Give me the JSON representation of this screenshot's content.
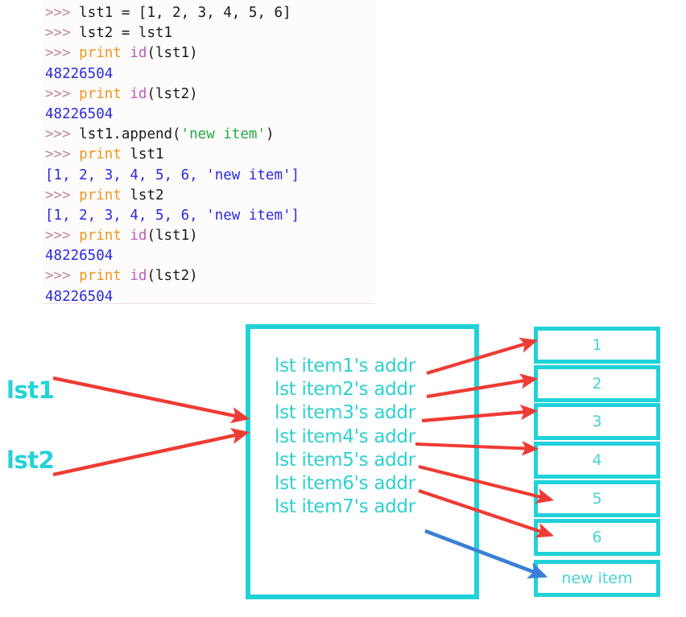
{
  "console": {
    "lines": [
      [
        {
          "t": ">>> ",
          "c": "prompt"
        },
        {
          "t": "lst1 = [1, 2, 3, 4, 5, 6]",
          "c": "plain"
        }
      ],
      [
        {
          "t": ">>> ",
          "c": "prompt"
        },
        {
          "t": "lst2 = lst1",
          "c": "plain"
        }
      ],
      [
        {
          "t": ">>> ",
          "c": "prompt"
        },
        {
          "t": "print ",
          "c": "keyword"
        },
        {
          "t": "id",
          "c": "builtin"
        },
        {
          "t": "(lst1)",
          "c": "plain"
        }
      ],
      [
        {
          "t": "48226504",
          "c": "output"
        }
      ],
      [
        {
          "t": ">>> ",
          "c": "prompt"
        },
        {
          "t": "print ",
          "c": "keyword"
        },
        {
          "t": "id",
          "c": "builtin"
        },
        {
          "t": "(lst2)",
          "c": "plain"
        }
      ],
      [
        {
          "t": "48226504",
          "c": "output"
        }
      ],
      [
        {
          "t": ">>> ",
          "c": "prompt"
        },
        {
          "t": "lst1.append(",
          "c": "plain"
        },
        {
          "t": "'new item'",
          "c": "string"
        },
        {
          "t": ")",
          "c": "plain"
        }
      ],
      [
        {
          "t": ">>> ",
          "c": "prompt"
        },
        {
          "t": "print ",
          "c": "keyword"
        },
        {
          "t": "lst1",
          "c": "plain"
        }
      ],
      [
        {
          "t": "[1, 2, 3, 4, 5, 6, 'new item']",
          "c": "output"
        }
      ],
      [
        {
          "t": ">>> ",
          "c": "prompt"
        },
        {
          "t": "print ",
          "c": "keyword"
        },
        {
          "t": "lst2",
          "c": "plain"
        }
      ],
      [
        {
          "t": "[1, 2, 3, 4, 5, 6, 'new item']",
          "c": "output"
        }
      ],
      [
        {
          "t": ">>> ",
          "c": "prompt"
        },
        {
          "t": "print ",
          "c": "keyword"
        },
        {
          "t": "id",
          "c": "builtin"
        },
        {
          "t": "(lst1)",
          "c": "plain"
        }
      ],
      [
        {
          "t": "48226504",
          "c": "output"
        }
      ],
      [
        {
          "t": ">>> ",
          "c": "prompt"
        },
        {
          "t": "print ",
          "c": "keyword"
        },
        {
          "t": "id",
          "c": "builtin"
        },
        {
          "t": "(lst2)",
          "c": "plain"
        }
      ],
      [
        {
          "t": "48226504",
          "c": "output"
        }
      ]
    ],
    "token_colors": {
      "prompt": "#c08a96",
      "plain": "#1a1a1a",
      "keyword": "#f2941e",
      "builtin": "#c158c1",
      "string": "#22aa44",
      "output": "#2a2ae0"
    }
  },
  "diagram": {
    "variables": [
      {
        "name": "lst1",
        "label": "lst1"
      },
      {
        "name": "lst2",
        "label": "lst2"
      }
    ],
    "list_object_slots": [
      "lst item1's addr",
      "lst item2's addr",
      "lst item3's addr",
      "lst item4's addr",
      "lst item5's addr",
      "lst item6's addr",
      "lst item7's addr"
    ],
    "values": [
      "1",
      "2",
      "3",
      "4",
      "5",
      "6",
      "new item"
    ],
    "colors": {
      "cyan_border": "#20d2d8",
      "cyan_text": "#2fd0cf",
      "value_text": "#46d4d2",
      "label_text": "#23d3d7",
      "red_arrow": "#ef3b35",
      "blue_arrow": "#3a7fd5"
    },
    "arrows": [
      {
        "name": "lst1-to-list-object",
        "color": "red"
      },
      {
        "name": "lst2-to-list-object",
        "color": "red"
      },
      {
        "name": "slot1-to-value1",
        "color": "red"
      },
      {
        "name": "slot2-to-value2",
        "color": "red"
      },
      {
        "name": "slot3-to-value3",
        "color": "red"
      },
      {
        "name": "slot4-to-value4",
        "color": "red"
      },
      {
        "name": "slot5-to-value5",
        "color": "red"
      },
      {
        "name": "slot6-to-value6",
        "color": "red"
      },
      {
        "name": "slot7-to-new-item",
        "color": "blue"
      }
    ]
  }
}
